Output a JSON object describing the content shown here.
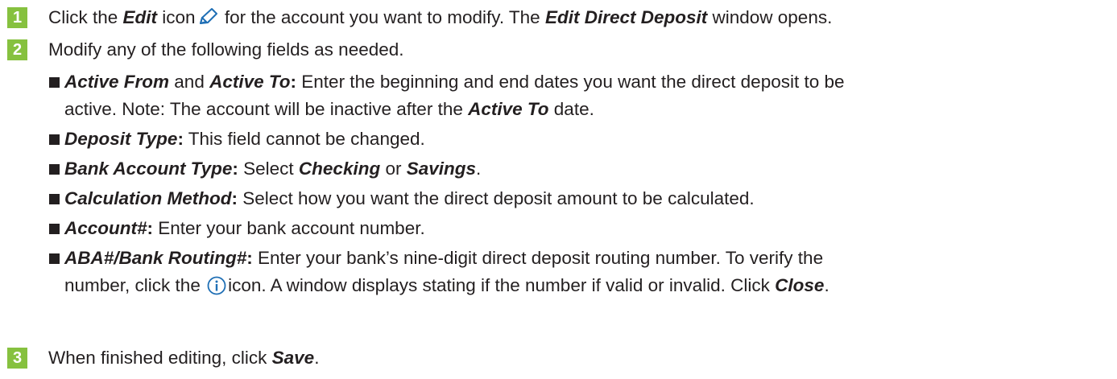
{
  "colors": {
    "step_badge": "#86c13f",
    "icon_blue": "#1f6fb5",
    "text": "#231f20"
  },
  "icons": {
    "edit": "pencil-icon",
    "info": "info-circle-icon"
  },
  "step1": {
    "number": "1",
    "t1": "Click the ",
    "edit": "Edit",
    "t2": " icon",
    "t3": " for the account you want to modify. The ",
    "window": "Edit Direct Deposit",
    "t4": " window opens."
  },
  "step2": {
    "number": "2",
    "text": "Modify any of the following fields as needed."
  },
  "bullets": {
    "active": {
      "term1": "Active From",
      "and": " and ",
      "term2": "Active To",
      "colon": ":",
      "text1": " Enter the beginning and end dates you want the direct deposit to be",
      "text2": "active. Note: The account will be inactive after the ",
      "term3": "Active To",
      "text3": " date."
    },
    "deposit_type": {
      "term": "Deposit Type",
      "colon": ":",
      "text": " This field cannot be changed."
    },
    "bank_account_type": {
      "term": "Bank Account Type",
      "colon": ":",
      "text1": " Select ",
      "opt1": "Checking",
      "or": " or ",
      "opt2": "Savings",
      "end": "."
    },
    "calculation_method": {
      "term": "Calculation Method",
      "colon": ":",
      "text": " Select how you want the direct deposit amount to be calculated."
    },
    "account": {
      "term": "Account#",
      "colon": ":",
      "text": " Enter your bank account number."
    },
    "aba": {
      "term": "ABA#/Bank Routing#",
      "colon": ":",
      "text1": " Enter your bank’s nine-digit direct deposit routing number. To verify the",
      "text2": "number, click the ",
      "text3": "icon. A window displays stating if the number if valid or invalid. Click ",
      "close": "Close",
      "end": "."
    }
  },
  "step3": {
    "number": "3",
    "text": "When finished editing, click ",
    "save": "Save",
    "end": "."
  }
}
